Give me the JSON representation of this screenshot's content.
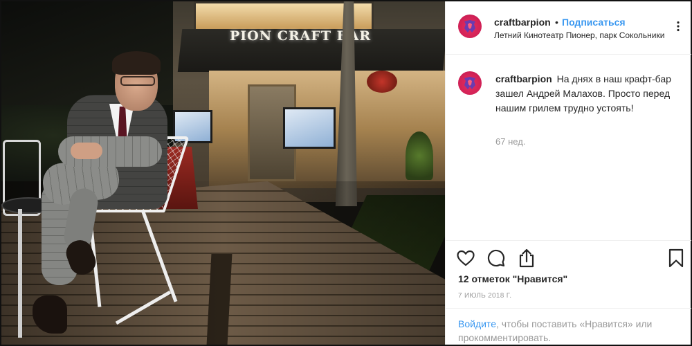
{
  "post": {
    "photo": {
      "sign_text": "PION CRAFT BAR"
    },
    "header": {
      "username": "craftbarpion",
      "separator": "•",
      "follow_label": "Подписаться",
      "location": "Летний Кинотеатр Пионер, парк Сокольники"
    },
    "caption": {
      "username": "craftbarpion",
      "text": "На днях в наш крафт-бар зашел Андрей Малахов. Просто перед нашим грилем трудно устоять!",
      "time_ago": "67 нед."
    },
    "actions": {
      "like_icon": "heart-icon",
      "comment_icon": "comment-icon",
      "share_icon": "share-icon",
      "save_icon": "bookmark-icon"
    },
    "likes_text": "12 отметок \"Нравится\"",
    "date_text": "7 ИЮЛЬ 2018 Г.",
    "login_prompt": {
      "link_label": "Войдите",
      "rest": ", чтобы поставить «Нравится» или прокомментировать."
    },
    "colors": {
      "link": "#3897f0",
      "avatar": "#d32257",
      "muted": "#999999"
    }
  }
}
